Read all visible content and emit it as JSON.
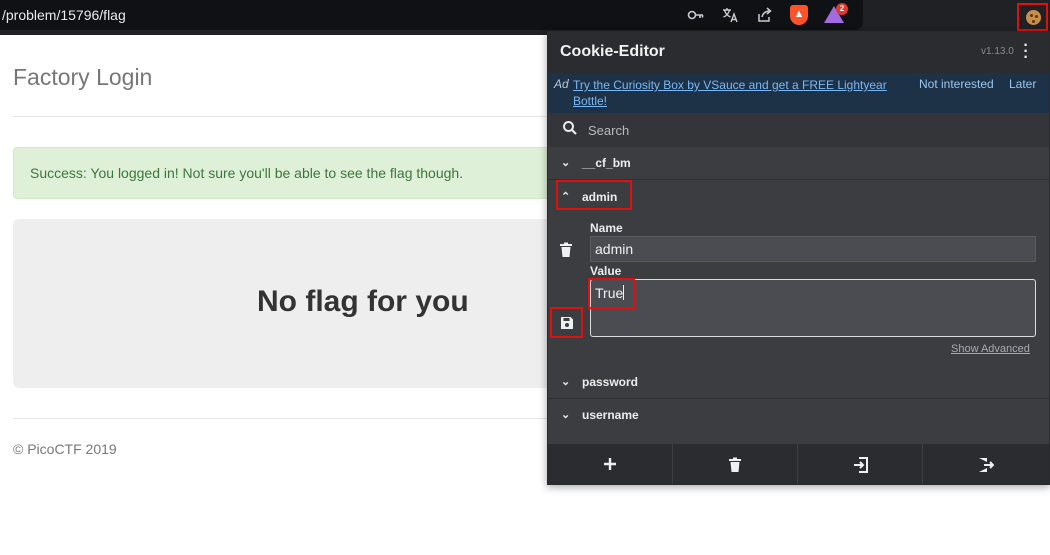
{
  "browser": {
    "url": "/problem/15796/flag",
    "icons": [
      "key-icon",
      "translate-icon",
      "share-icon",
      "brave-shields-icon",
      "brave-rewards-icon",
      "cookie-editor-extension-icon"
    ],
    "rewards_badge": "2"
  },
  "page": {
    "title": "Factory Login",
    "alert": "Success: You logged in! Not sure you'll be able to see the flag though.",
    "jumbotron": "No flag for you",
    "footer": "© PicoCTF 2019"
  },
  "cookie_editor": {
    "title": "Cookie-Editor",
    "version": "v1.13.0",
    "ad": {
      "label": "Ad",
      "text": "Try the Curiosity Box by VSauce and get a FREE Lightyear Bottle!",
      "not_interested": "Not interested",
      "later": "Later"
    },
    "search_placeholder": "Search",
    "cookies": [
      {
        "name": "__cf_bm",
        "expanded": false
      },
      {
        "name": "admin",
        "expanded": true
      },
      {
        "name": "password",
        "expanded": false
      },
      {
        "name": "username",
        "expanded": false
      }
    ],
    "details": {
      "name_label": "Name",
      "name_value": "admin",
      "value_label": "Value",
      "value_value": "True",
      "show_advanced": "Show Advanced"
    },
    "footer_buttons": [
      "add-cookie",
      "delete-all",
      "import",
      "export"
    ],
    "colors": {
      "highlight": "#e01010",
      "link": "#7ab8f5",
      "panel": "#3b3d41"
    }
  }
}
